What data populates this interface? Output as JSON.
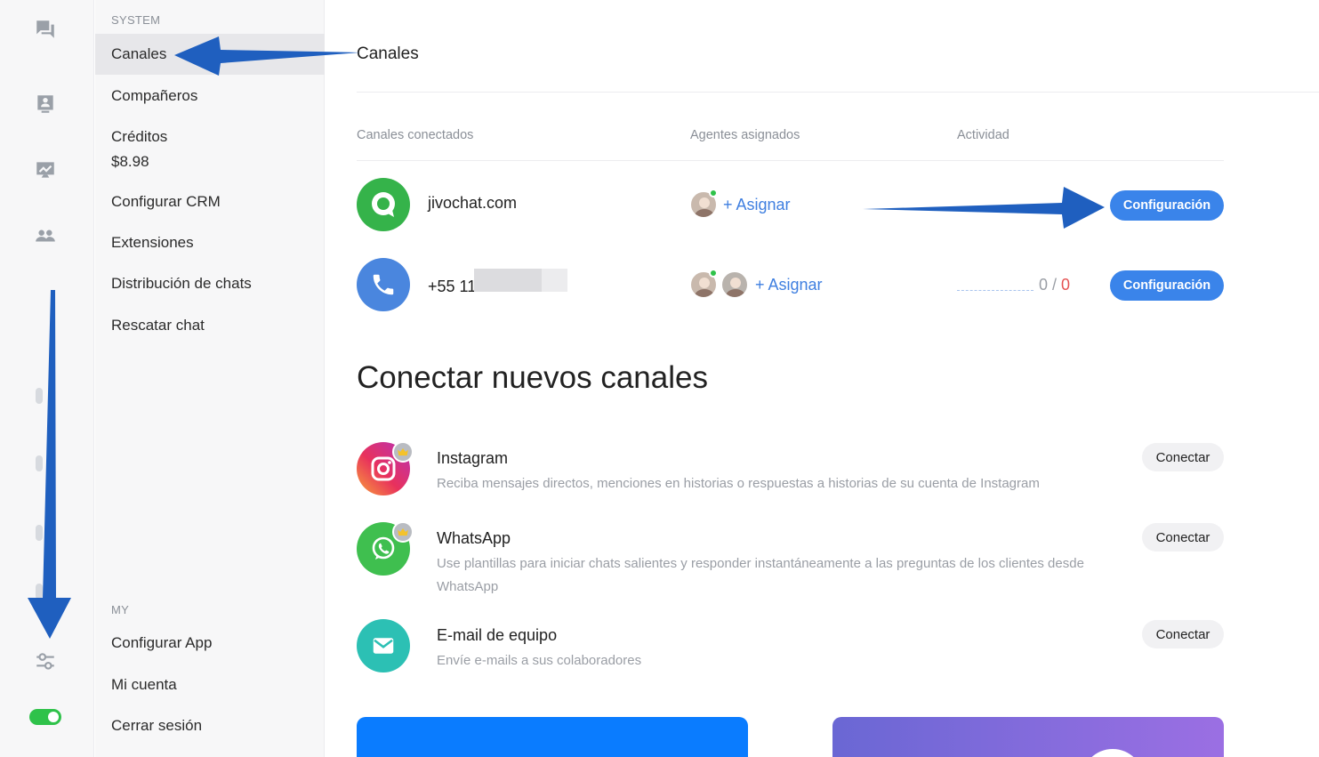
{
  "menu": {
    "section_system": "SYSTEM",
    "section_my": "MY",
    "items": [
      {
        "label": "Canales"
      },
      {
        "label": "Compañeros"
      },
      {
        "label": "Créditos",
        "sub": "$8.98"
      },
      {
        "label": "Configurar CRM"
      },
      {
        "label": "Extensiones"
      },
      {
        "label": "Distribución de chats"
      },
      {
        "label": "Rescatar chat"
      }
    ],
    "my_items": [
      {
        "label": "Configurar App"
      },
      {
        "label": "Mi cuenta"
      },
      {
        "label": "Cerrar sesión"
      }
    ]
  },
  "rail": {
    "icons": [
      "chats-icon",
      "contacts-icon",
      "reports-icon",
      "team-icon",
      "phone-icon",
      "tag-icon",
      "settings-sliders-icon"
    ],
    "toggle_on": true
  },
  "main": {
    "title": "Canales",
    "columns": {
      "connected": "Canales conectados",
      "agents": "Agentes asignados",
      "activity": "Actividad"
    },
    "channels": [
      {
        "name": "jivochat.com",
        "assign": "+ Asignar",
        "config": "Configuración"
      },
      {
        "name": "+55 11",
        "assign": "+ Asignar",
        "ratio_left": "0",
        "ratio_sep": " / ",
        "ratio_right": "0",
        "config": "Configuración"
      }
    ],
    "new_section_title": "Conectar nuevos canales",
    "new_channels": [
      {
        "title": "Instagram",
        "desc": "Reciba mensajes directos, menciones en historias o respuestas a historias de su cuenta de Instagram",
        "button": "Conectar"
      },
      {
        "title": "WhatsApp",
        "desc": "Use plantillas para iniciar chats salientes y responder instantáneamente a las preguntas de los clientes desde WhatsApp",
        "button": "Conectar"
      },
      {
        "title": "E-mail de equipo",
        "desc": "Envíe e-mails a sus colaboradores",
        "button": "Conectar"
      }
    ]
  },
  "colors": {
    "accent": "#3a84ea",
    "online": "#2fc24a",
    "annotation_arrow": "#1f5fbf"
  }
}
